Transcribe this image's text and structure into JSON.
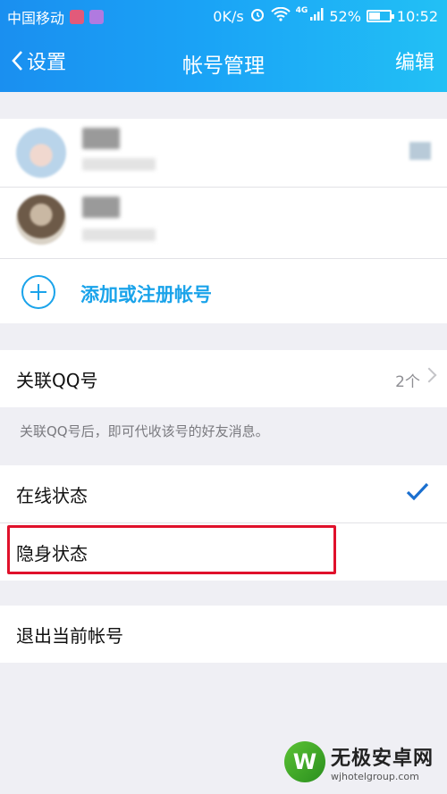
{
  "statusbar": {
    "carrier": "中国移动",
    "speed": "0K/s",
    "network": "4G",
    "battery": "52%",
    "time": "10:52"
  },
  "navbar": {
    "back_label": "设置",
    "title": "帐号管理",
    "edit_label": "编辑"
  },
  "accounts": {
    "add_label": "添加或注册帐号"
  },
  "linked_qq": {
    "label": "关联QQ号",
    "count": "2个",
    "hint": "关联QQ号后，即可代收该号的好友消息。"
  },
  "status_options": {
    "online": "在线状态",
    "invisible": "隐身状态",
    "selected": "online"
  },
  "logout": {
    "label": "退出当前帐号"
  },
  "watermark": {
    "title": "无极安卓网",
    "url": "wjhotelgroup.com"
  },
  "colors": {
    "accent": "#1aa3ea",
    "highlight_box": "#e0112b",
    "header_gradient_start": "#1a8ff0",
    "header_gradient_end": "#22c0f5"
  }
}
